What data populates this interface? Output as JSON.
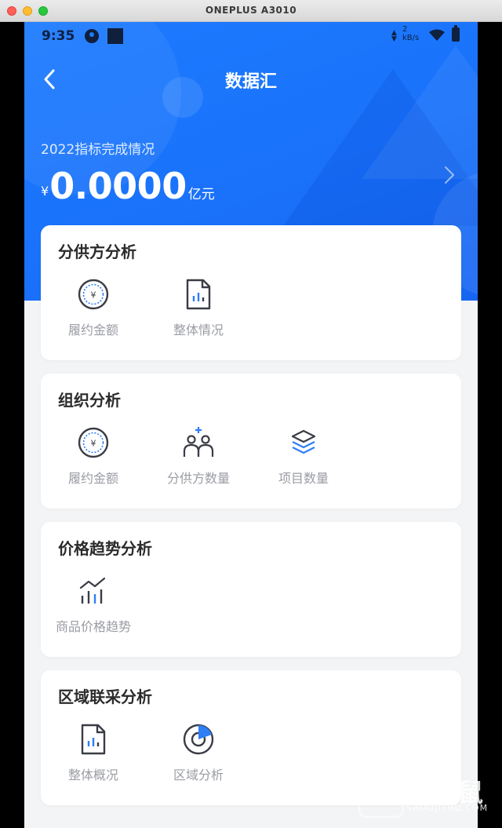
{
  "window": {
    "title": "ONEPLUS A3010"
  },
  "status_bar": {
    "time": "9:35",
    "net_speed_value": "2",
    "net_speed_unit": "kB/s"
  },
  "header": {
    "title": "数据汇"
  },
  "summary": {
    "label": "2022指标完成情况",
    "currency": "¥",
    "value": "0.0000",
    "unit": "亿元"
  },
  "cards": [
    {
      "title": "分供方分析",
      "items": [
        {
          "label": "履约金额",
          "icon": "yuan-coin-icon"
        },
        {
          "label": "整体情况",
          "icon": "report-document-icon"
        }
      ]
    },
    {
      "title": "组织分析",
      "items": [
        {
          "label": "履约金额",
          "icon": "yuan-coin-icon"
        },
        {
          "label": "分供方数量",
          "icon": "add-people-icon"
        },
        {
          "label": "项目数量",
          "icon": "layers-icon"
        }
      ]
    },
    {
      "title": "价格趋势分析",
      "items": [
        {
          "label": "商品价格趋势",
          "icon": "trend-chart-icon"
        }
      ]
    },
    {
      "title": "区域联采分析",
      "items": [
        {
          "label": "整体概况",
          "icon": "report-document-icon"
        },
        {
          "label": "区域分析",
          "icon": "pie-chart-icon"
        }
      ]
    }
  ],
  "watermark": {
    "text": "手机鼠",
    "subtext": "SHOUJISHU.COM"
  },
  "colors": {
    "accent": "#1a72fa",
    "icon_dark": "#3a3d45",
    "icon_blue": "#2f7ef5",
    "label_gray": "#9a9ca3"
  }
}
